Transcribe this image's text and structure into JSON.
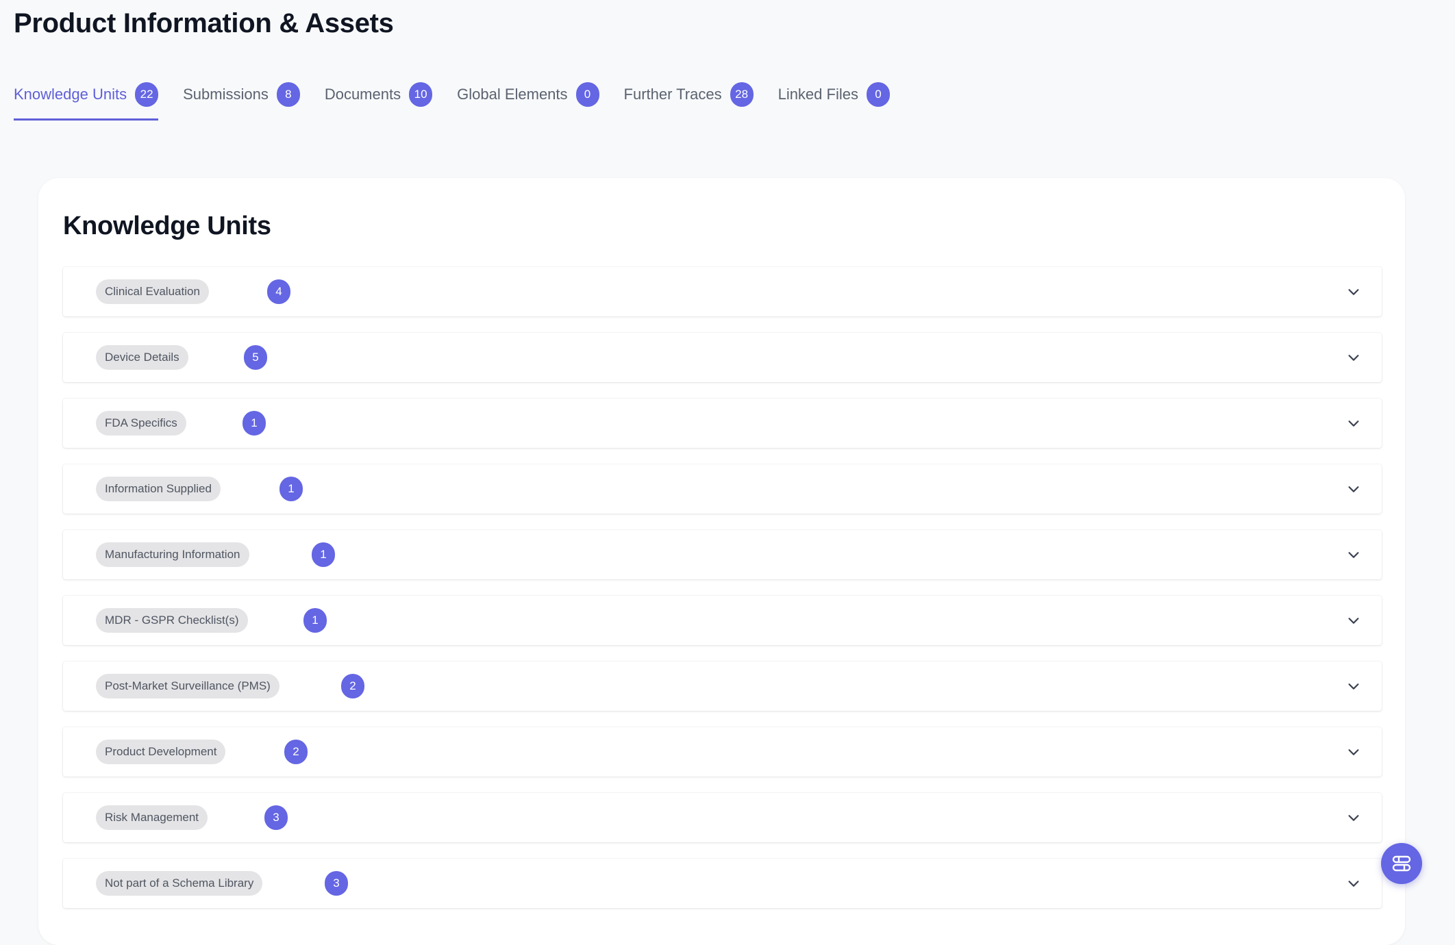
{
  "page_title": "Product Information & Assets",
  "tabs": [
    {
      "label": "Knowledge Units",
      "count": "22",
      "active": true
    },
    {
      "label": "Submissions",
      "count": "8",
      "active": false
    },
    {
      "label": "Documents",
      "count": "10",
      "active": false
    },
    {
      "label": "Global Elements",
      "count": "0",
      "active": false
    },
    {
      "label": "Further Traces",
      "count": "28",
      "active": false
    },
    {
      "label": "Linked Files",
      "count": "0",
      "active": false
    }
  ],
  "section_title": "Knowledge Units",
  "units": [
    {
      "label": "Clinical Evaluation",
      "count": "4"
    },
    {
      "label": "Device Details",
      "count": "5"
    },
    {
      "label": "FDA Specifics",
      "count": "1"
    },
    {
      "label": "Information Supplied",
      "count": "1"
    },
    {
      "label": "Manufacturing Information",
      "count": "1"
    },
    {
      "label": "MDR - GSPR Checklist(s)",
      "count": "1"
    },
    {
      "label": "Post-Market Surveillance (PMS)",
      "count": "2"
    },
    {
      "label": "Product Development",
      "count": "2"
    },
    {
      "label": "Risk Management",
      "count": "3"
    },
    {
      "label": "Not part of a Schema Library",
      "count": "3"
    }
  ],
  "icons": {
    "expand": "chevron-down-icon",
    "fab": "command-icon"
  },
  "colors": {
    "accent": "#6466e3",
    "tag_bg": "#e4e4e6",
    "background": "#f8f9fa"
  }
}
